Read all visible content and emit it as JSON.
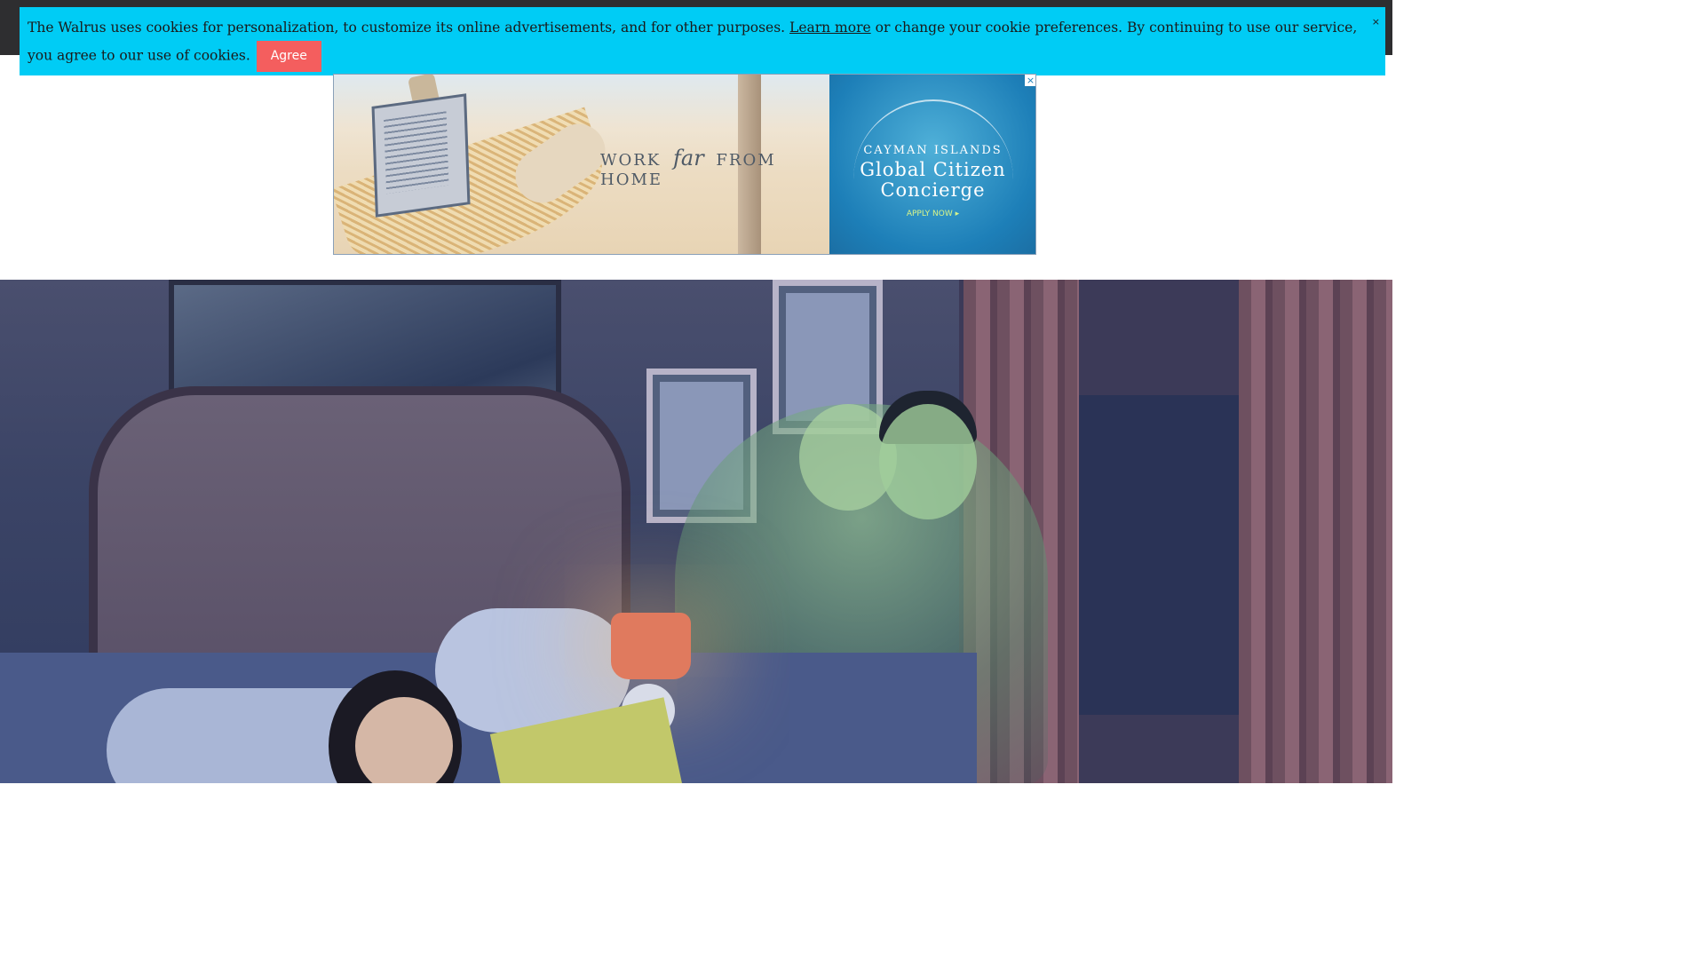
{
  "cookie_banner": {
    "text_before": "The Walrus uses cookies for personalization, to customize its online advertisements, and for other purposes.",
    "learn_more": "Learn more",
    "text_after": "or change your cookie preferences. By continuing to use our service, you agree to our use of cookies.",
    "agree_label": "Agree",
    "close_glyph": "×"
  },
  "ad": {
    "tagline_pre": "WORK",
    "tagline_em": "far",
    "tagline_post": "FROM HOME",
    "brand_top": "CAYMAN ISLANDS",
    "brand_main": "Global Citizen Concierge",
    "cta": "APPLY NOW ▸",
    "close_glyph": "×"
  },
  "colors": {
    "banner_bg": "#00ccf5",
    "agree_bg": "#f45e5e",
    "topbar": "#2e2e30"
  },
  "icons": [
    "close-icon",
    "ad-close-icon"
  ]
}
